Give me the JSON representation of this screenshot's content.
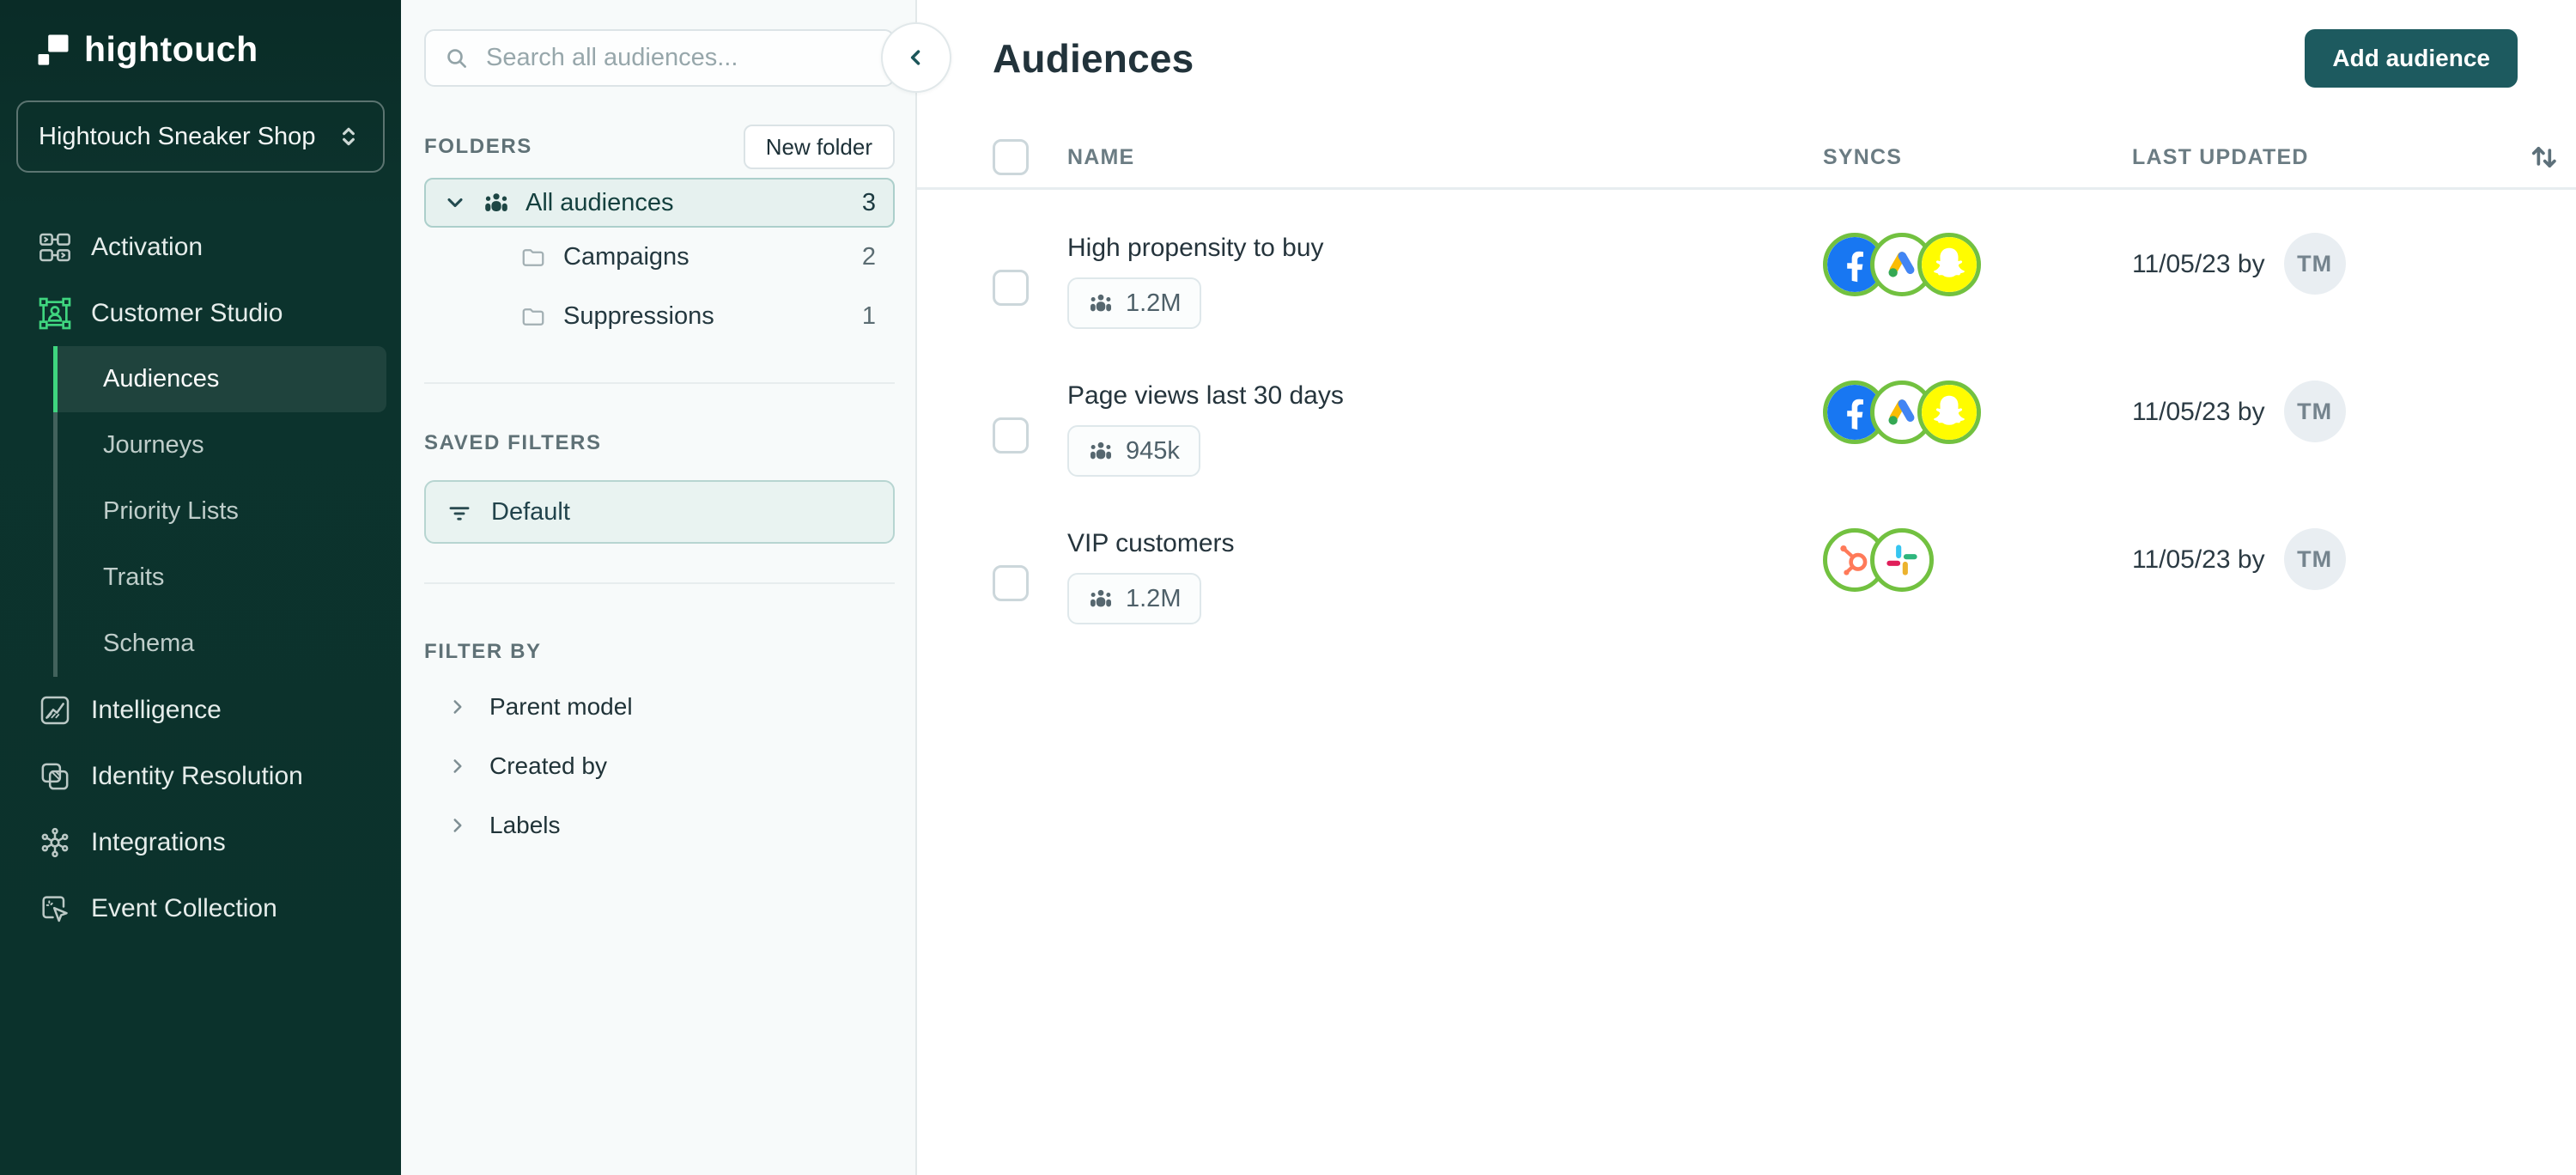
{
  "brand": {
    "logo_text": "hightouch",
    "workspace_name": "Hightouch Sneaker Shop"
  },
  "sidebar": {
    "items": [
      {
        "label": "Activation",
        "icon": "activation-icon"
      },
      {
        "label": "Customer Studio",
        "icon": "customer-studio-icon"
      },
      {
        "label": "Intelligence",
        "icon": "intelligence-icon"
      },
      {
        "label": "Identity Resolution",
        "icon": "identity-resolution-icon"
      },
      {
        "label": "Integrations",
        "icon": "integrations-icon"
      },
      {
        "label": "Event Collection",
        "icon": "event-collection-icon"
      }
    ],
    "customer_studio_children": [
      {
        "label": "Audiences",
        "active": true
      },
      {
        "label": "Journeys",
        "active": false
      },
      {
        "label": "Priority Lists",
        "active": false
      },
      {
        "label": "Traits",
        "active": false
      },
      {
        "label": "Schema",
        "active": false
      }
    ]
  },
  "panel": {
    "search_placeholder": "Search all audiences...",
    "folders_header": "FOLDERS",
    "new_folder_label": "New folder",
    "folders": [
      {
        "label": "All audiences",
        "count": "3",
        "selected": true,
        "icon": "audience-people-icon"
      },
      {
        "label": "Campaigns",
        "count": "2",
        "selected": false,
        "icon": "folder-icon"
      },
      {
        "label": "Suppressions",
        "count": "1",
        "selected": false,
        "icon": "folder-icon"
      }
    ],
    "saved_filters_header": "SAVED FILTERS",
    "saved_filters": [
      {
        "label": "Default",
        "icon": "filter-icon"
      }
    ],
    "filter_by_header": "FILTER BY",
    "filter_by": [
      {
        "label": "Parent model"
      },
      {
        "label": "Created by"
      },
      {
        "label": "Labels"
      }
    ]
  },
  "main": {
    "title": "Audiences",
    "add_button_label": "Add audience",
    "table": {
      "columns": [
        "NAME",
        "SYNCS",
        "LAST UPDATED"
      ],
      "rows": [
        {
          "name": "High propensity to buy",
          "size": "1.2M",
          "syncs": [
            "facebook",
            "google-ads",
            "snapchat"
          ],
          "last_updated": "11/05/23 by",
          "updated_by_initials": "TM"
        },
        {
          "name": "Page views last 30 days",
          "size": "945k",
          "syncs": [
            "facebook",
            "google-ads",
            "snapchat"
          ],
          "last_updated": "11/05/23 by",
          "updated_by_initials": "TM"
        },
        {
          "name": "VIP customers",
          "size": "1.2M",
          "syncs": [
            "hubspot",
            "slack"
          ],
          "last_updated": "11/05/23 by",
          "updated_by_initials": "TM"
        }
      ]
    }
  },
  "colors": {
    "sidebar_bg": "#0b322c",
    "accent_green": "#3fd57f",
    "sync_ring_green": "#72c140",
    "button_teal": "#1d5a5f",
    "selected_row_bg": "#e6f1ef",
    "facebook_blue": "#1877F2",
    "snapchat_yellow": "#FFFC00",
    "hubspot_orange": "#FF7A59",
    "google_blue": "#4285F4",
    "google_yellow": "#FBBC04",
    "google_green": "#34A853",
    "slack_blue": "#36C5F0",
    "slack_green": "#2EB67D",
    "slack_yellow": "#ECB22E",
    "slack_red": "#E01E5A"
  }
}
